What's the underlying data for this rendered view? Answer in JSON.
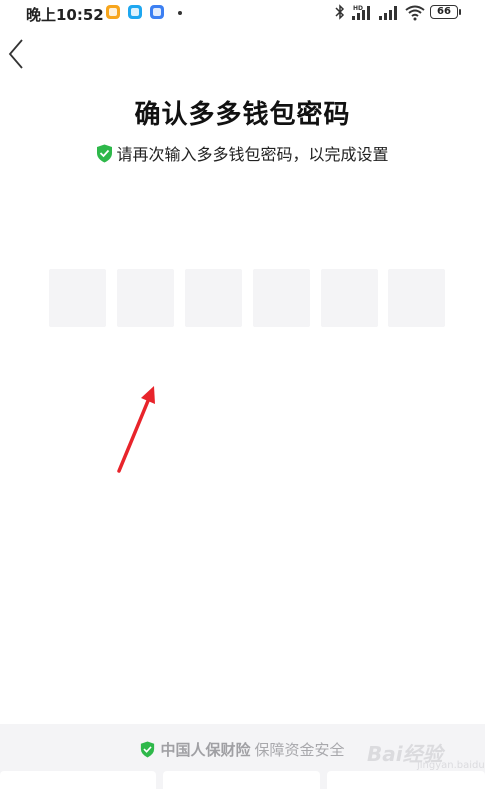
{
  "status_bar": {
    "time": "晚上10:52",
    "battery": "66",
    "icons": [
      "bluetooth-icon",
      "signal-hd-icon",
      "signal-icon",
      "wifi-icon",
      "battery-icon"
    ]
  },
  "nav": {
    "back_icon": "chevron-left-icon"
  },
  "main": {
    "title": "确认多多钱包密码",
    "subtitle": "请再次输入多多钱包密码，以完成设置",
    "pin_length": 6
  },
  "footer": {
    "brand": "中国人保财险",
    "text": "保障资金安全"
  },
  "watermark": {
    "text": "Bai经验",
    "sub": "jingyan.baidu.com"
  },
  "colors": {
    "shield_green": "#2eb84a",
    "arrow_red": "#e8242b",
    "pin_box": "#f4f4f6"
  }
}
